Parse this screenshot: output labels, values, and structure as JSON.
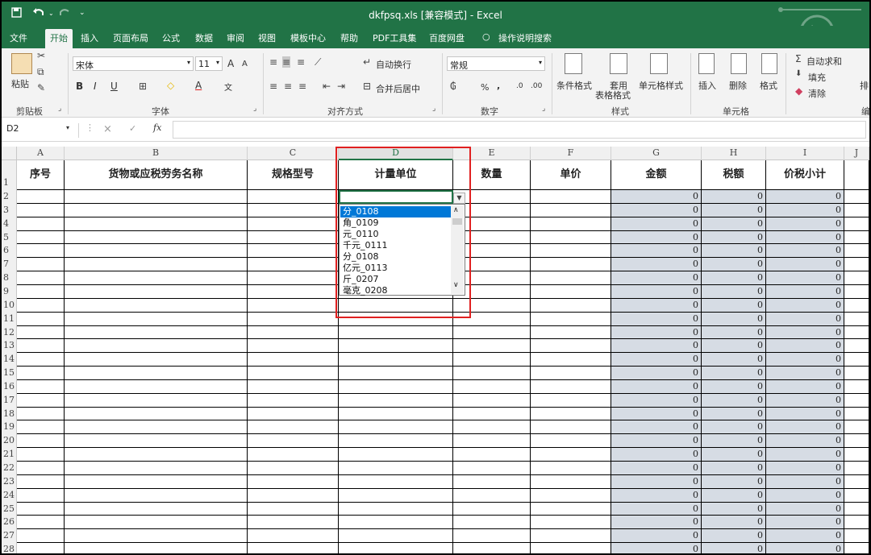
{
  "titlebar": {
    "title": "dkfpsq.xls [兼容模式] - Excel",
    "save_icon": "save-icon",
    "undo_icon": "undo-icon",
    "redo_icon": "redo-icon"
  },
  "menu": [
    "文件",
    "开始",
    "插入",
    "页面布局",
    "公式",
    "数据",
    "审阅",
    "视图",
    "模板中心",
    "帮助",
    "PDF工具集",
    "百度网盘",
    "操作说明搜索"
  ],
  "ribbon": {
    "clipboard": {
      "paste": "粘贴",
      "group": "剪贴板"
    },
    "font": {
      "name": "宋体",
      "size": "11",
      "bold": "B",
      "italic": "I",
      "underline": "U",
      "color_a": "A",
      "group": "字体",
      "grow": "A",
      "shrink": "A",
      "phonetic": "文"
    },
    "align": {
      "wrap": "自动换行",
      "merge": "合并后居中",
      "group": "对齐方式"
    },
    "number": {
      "format": "常规",
      "percent": "%",
      "comma": ",",
      "inc": ".0",
      "dec": ".00",
      "group": "数字"
    },
    "styles": {
      "cond": "条件格式",
      "table_l1": "套用",
      "table_l2": "表格格式",
      "cell": "单元格样式",
      "group": "样式"
    },
    "cells": {
      "insert": "插入",
      "delete": "删除",
      "format": "格式",
      "group": "单元格"
    },
    "editing": {
      "autosum": "自动求和",
      "fill": "填充",
      "clear": "清除",
      "sort": "排",
      "edit": "编"
    }
  },
  "formula_bar": {
    "namebox": "D2",
    "fx": "fx",
    "cancel": "×",
    "enter": "✓"
  },
  "columns": [
    "A",
    "B",
    "C",
    "D",
    "E",
    "F",
    "G",
    "H",
    "I",
    "J"
  ],
  "headers": [
    "序号",
    "货物或应税劳务名称",
    "规格型号",
    "计量单位",
    "数量",
    "单价",
    "金额",
    "税额",
    "价税小计"
  ],
  "row_numbers": [
    "1",
    "2",
    "3",
    "4",
    "5",
    "6",
    "7",
    "8",
    "9",
    "10",
    "11",
    "12",
    "13",
    "14",
    "15",
    "16",
    "17",
    "18",
    "19",
    "20",
    "21",
    "22",
    "23",
    "24",
    "25",
    "26",
    "27",
    "28"
  ],
  "zero": "0",
  "dropdown": {
    "options": [
      "分_0108",
      "角_0109",
      "元_0110",
      "千元_0111",
      "分_0108",
      "亿元_0113",
      "斤_0207",
      "毫克_0208"
    ],
    "selected_index": 0
  },
  "colors": {
    "excel_green": "#217346",
    "highlight": "#e02020",
    "shade": "#d6dce4",
    "selection": "#0078d7"
  }
}
